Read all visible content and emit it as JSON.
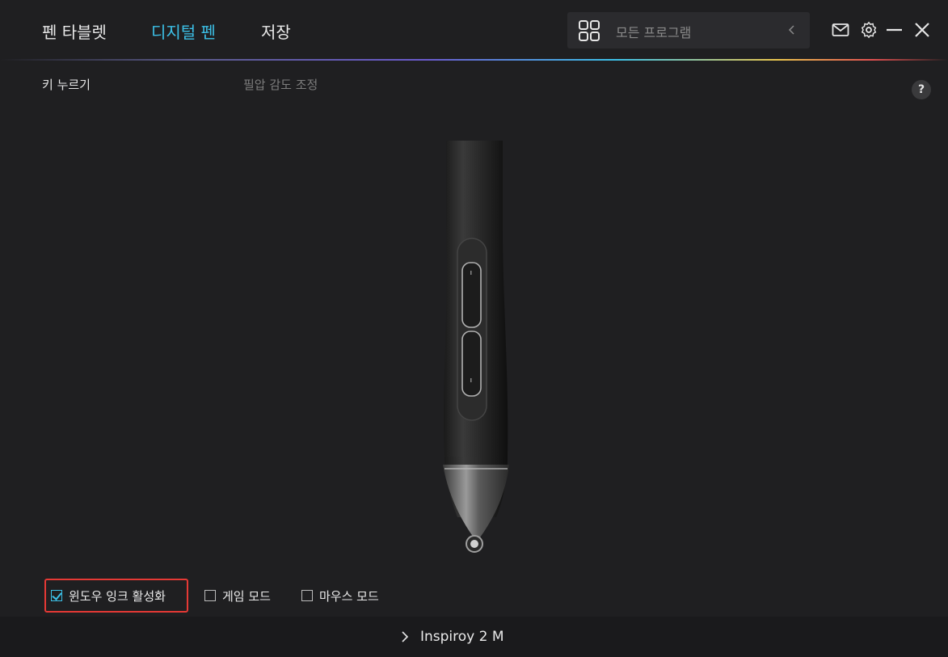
{
  "nav": {
    "tabs": [
      {
        "label": "펜 타블렛"
      },
      {
        "label": "디지털 펜"
      },
      {
        "label": "저장"
      }
    ],
    "active_color": "#3cc1e8"
  },
  "program_selector": {
    "label": "모든 프로그램",
    "icon": "grid-icon"
  },
  "window_controls": [
    "mail-icon",
    "gear-icon",
    "minimize-icon",
    "close-icon"
  ],
  "subtabs": [
    {
      "label": "키 누르기"
    },
    {
      "label": "필압 감도 조정"
    }
  ],
  "help": {
    "label": "?"
  },
  "options": [
    {
      "label": "윈도우 잉크 활성화",
      "checked": true
    },
    {
      "label": "게임 모드",
      "checked": false
    },
    {
      "label": "마우스 모드",
      "checked": false
    }
  ],
  "device": {
    "name": "Inspiroy 2 M"
  }
}
